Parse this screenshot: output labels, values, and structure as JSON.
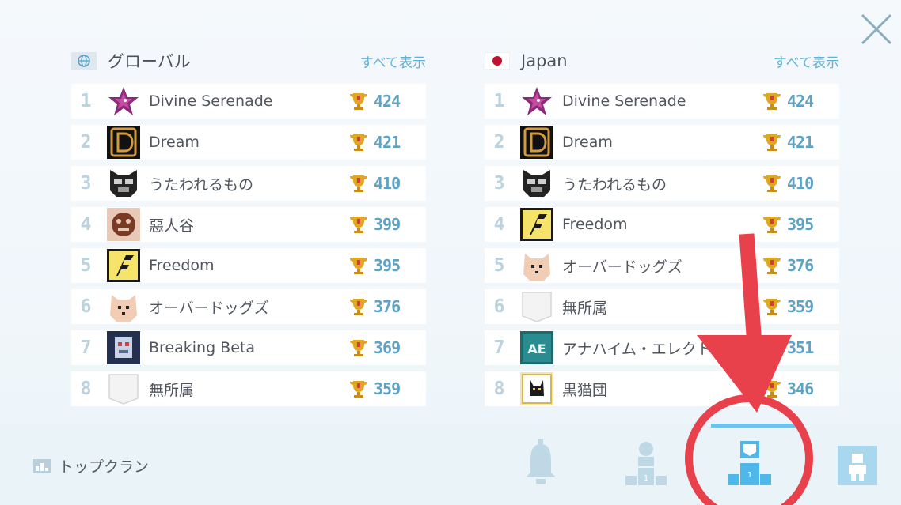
{
  "close_label": "close",
  "columns": {
    "global": {
      "title": "グローバル",
      "see_all": "すべて表示",
      "rows": [
        {
          "rank": "1",
          "name": "Divine Serenade",
          "score": "424",
          "emblem": "star"
        },
        {
          "rank": "2",
          "name": "Dream",
          "score": "421",
          "emblem": "d-logo"
        },
        {
          "rank": "3",
          "name": "うたわれるもの",
          "score": "410",
          "emblem": "mask"
        },
        {
          "rank": "4",
          "name": "惡人谷",
          "score": "399",
          "emblem": "tiger"
        },
        {
          "rank": "5",
          "name": "Freedom",
          "score": "395",
          "emblem": "f-logo"
        },
        {
          "rank": "6",
          "name": "オーバードッグズ",
          "score": "376",
          "emblem": "dog"
        },
        {
          "rank": "7",
          "name": "Breaking Beta",
          "score": "369",
          "emblem": "robot"
        },
        {
          "rank": "8",
          "name": "無所属",
          "score": "359",
          "emblem": "blank"
        }
      ]
    },
    "japan": {
      "title": "Japan",
      "see_all": "すべて表示",
      "rows": [
        {
          "rank": "1",
          "name": "Divine Serenade",
          "score": "424",
          "emblem": "star"
        },
        {
          "rank": "2",
          "name": "Dream",
          "score": "421",
          "emblem": "d-logo"
        },
        {
          "rank": "3",
          "name": "うたわれるもの",
          "score": "410",
          "emblem": "mask"
        },
        {
          "rank": "4",
          "name": "Freedom",
          "score": "395",
          "emblem": "f-logo"
        },
        {
          "rank": "5",
          "name": "オーバードッグズ",
          "score": "376",
          "emblem": "dog"
        },
        {
          "rank": "6",
          "name": "無所属",
          "score": "359",
          "emblem": "blank"
        },
        {
          "rank": "7",
          "name": "アナハイム・エレクトロ",
          "score": "351",
          "emblem": "ae-logo"
        },
        {
          "rank": "8",
          "name": "黒猫団",
          "score": "346",
          "emblem": "cat"
        }
      ]
    }
  },
  "bottom": {
    "label": "トップクラン"
  },
  "colors": {
    "accent": "#6cc3ee",
    "annotation": "#e8414c",
    "score": "#5fa3c4"
  }
}
